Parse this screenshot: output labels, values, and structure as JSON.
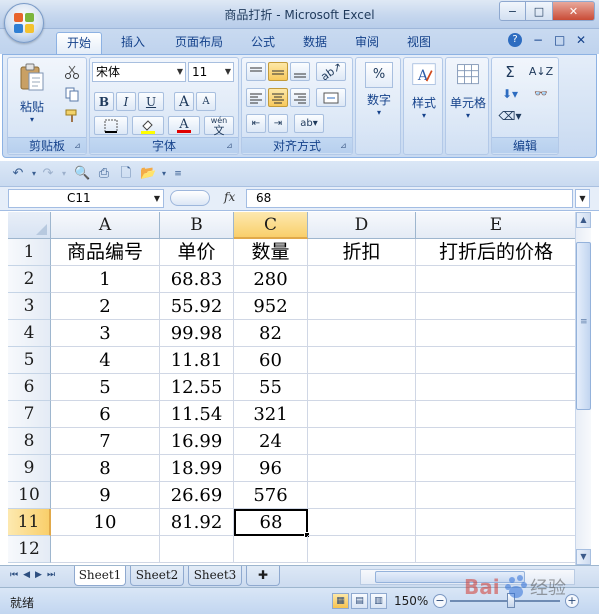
{
  "window": {
    "title": "商品打折 - Microsoft Excel",
    "controls": {
      "minimize": "−",
      "restore": "□",
      "close": "✕"
    }
  },
  "ribbon": {
    "tabs": [
      "开始",
      "插入",
      "页面布局",
      "公式",
      "数据",
      "审阅",
      "视图"
    ],
    "active_tab": "开始",
    "help": "?",
    "mdi": {
      "minimize": "−",
      "restore": "□",
      "close": "✕"
    },
    "groups": {
      "clipboard": {
        "label": "剪贴板",
        "paste_label": "粘贴"
      },
      "font": {
        "label": "字体",
        "font_name": "宋体",
        "font_size": "11",
        "bold": "B",
        "italic": "I",
        "underline": "U",
        "grow": "A",
        "shrink": "A",
        "font_color_glyph": "A",
        "phonetic": "wén"
      },
      "alignment": {
        "label": "对齐方式"
      },
      "number": {
        "label": "",
        "button_label": "数字",
        "glyph": "%"
      },
      "styles": {
        "label": "",
        "button_label": "样式"
      },
      "cells": {
        "label": "",
        "button_label": "单元格"
      },
      "editing": {
        "label": "编辑",
        "sum": "Σ"
      }
    }
  },
  "formula_bar": {
    "name_box": "C11",
    "fx": "fx",
    "formula": "68"
  },
  "sheet": {
    "columns": [
      "A",
      "B",
      "C",
      "D",
      "E"
    ],
    "rows": [
      "1",
      "2",
      "3",
      "4",
      "5",
      "6",
      "7",
      "8",
      "9",
      "10",
      "11",
      "12"
    ],
    "selected_cell": "C11",
    "selected_column": "C",
    "selected_row": "11",
    "header_row": [
      "商品编号",
      "单价",
      "数量",
      "折扣",
      "打折后的价格"
    ],
    "data": [
      [
        "1",
        "68.83",
        "280",
        "",
        ""
      ],
      [
        "2",
        "55.92",
        "952",
        "",
        ""
      ],
      [
        "3",
        "99.98",
        "82",
        "",
        ""
      ],
      [
        "4",
        "11.81",
        "60",
        "",
        ""
      ],
      [
        "5",
        "12.55",
        "55",
        "",
        ""
      ],
      [
        "6",
        "11.54",
        "321",
        "",
        ""
      ],
      [
        "7",
        "16.99",
        "24",
        "",
        ""
      ],
      [
        "8",
        "18.99",
        "96",
        "",
        ""
      ],
      [
        "9",
        "26.69",
        "576",
        "",
        ""
      ],
      [
        "10",
        "81.92",
        "68",
        "",
        ""
      ],
      [
        "",
        "",
        "",
        "",
        ""
      ]
    ]
  },
  "sheet_tabs": [
    "Sheet1",
    "Sheet2",
    "Sheet3"
  ],
  "active_sheet": "Sheet1",
  "status_bar": {
    "ready": "就绪",
    "zoom": "150%",
    "zoom_fraction": 0.55
  },
  "watermark": "Bai 经验"
}
